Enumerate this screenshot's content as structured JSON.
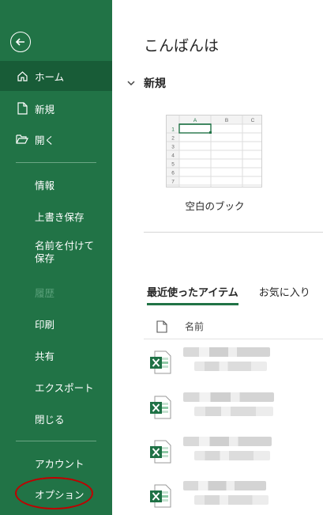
{
  "sidebar": {
    "back_icon": "arrow-left-circle-icon",
    "items": [
      {
        "label": "ホーム",
        "icon": "home-icon",
        "active": true
      },
      {
        "label": "新規",
        "icon": "new-document-icon"
      },
      {
        "label": "開く",
        "icon": "folder-open-icon"
      },
      {
        "label": "情報"
      },
      {
        "label": "上書き保存"
      },
      {
        "label": "名前を付けて保存"
      },
      {
        "label": "履歴",
        "disabled": true
      },
      {
        "label": "印刷"
      },
      {
        "label": "共有"
      },
      {
        "label": "エクスポート"
      },
      {
        "label": "閉じる"
      },
      {
        "label": "アカウント"
      },
      {
        "label": "オプション",
        "highlighted": true
      }
    ]
  },
  "main": {
    "greeting": "こんばんは",
    "new_section": {
      "title": "新規",
      "template": {
        "label": "空白のブック",
        "columns": [
          "A",
          "B",
          "C"
        ],
        "rows": [
          "1",
          "2",
          "3",
          "4",
          "5",
          "6",
          "7"
        ]
      }
    },
    "tabs": [
      {
        "label": "最近使ったアイテム",
        "active": true
      },
      {
        "label": "お気に入り"
      }
    ],
    "list_header": {
      "name_label": "名前"
    },
    "files": [
      {
        "icon": "excel-file-icon"
      },
      {
        "icon": "excel-file-icon"
      },
      {
        "icon": "excel-file-icon"
      },
      {
        "icon": "excel-file-icon"
      }
    ]
  },
  "colors": {
    "accent": "#217346",
    "accent_dark": "#185c37",
    "highlight_circle": "#c00000"
  }
}
